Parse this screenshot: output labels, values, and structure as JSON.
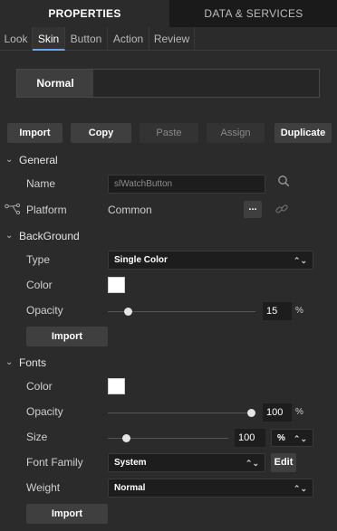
{
  "top_tabs": [
    "PROPERTIES",
    "DATA & SERVICES"
  ],
  "sub_tabs": [
    "Look",
    "Skin",
    "Button",
    "Action",
    "Review"
  ],
  "state": {
    "selected": "Normal"
  },
  "actions": {
    "import": "Import",
    "copy": "Copy",
    "paste": "Paste",
    "assign": "Assign",
    "duplicate": "Duplicate"
  },
  "general": {
    "title": "General",
    "name_label": "Name",
    "name_value": "slWatchButton",
    "platform_label": "Platform",
    "platform_value": "Common",
    "more": "..."
  },
  "background": {
    "title": "BackGround",
    "type_label": "Type",
    "type_value": "Single Color",
    "color_label": "Color",
    "color_value": "#ffffff",
    "opacity_label": "Opacity",
    "opacity_value": "15",
    "opacity_unit": "%",
    "import": "Import"
  },
  "fonts": {
    "title": "Fonts",
    "color_label": "Color",
    "color_value": "#ffffff",
    "opacity_label": "Opacity",
    "opacity_value": "100",
    "opacity_unit": "%",
    "size_label": "Size",
    "size_value": "100",
    "size_unit": "%",
    "family_label": "Font Family",
    "family_value": "System",
    "edit": "Edit",
    "weight_label": "Weight",
    "weight_value": "Normal",
    "import": "Import"
  },
  "icons": {
    "chevron": "chevron-down-icon",
    "search": "search-icon",
    "platform": "platform-tree-icon",
    "link": "link-icon",
    "updown": "sort-updown-icon"
  }
}
